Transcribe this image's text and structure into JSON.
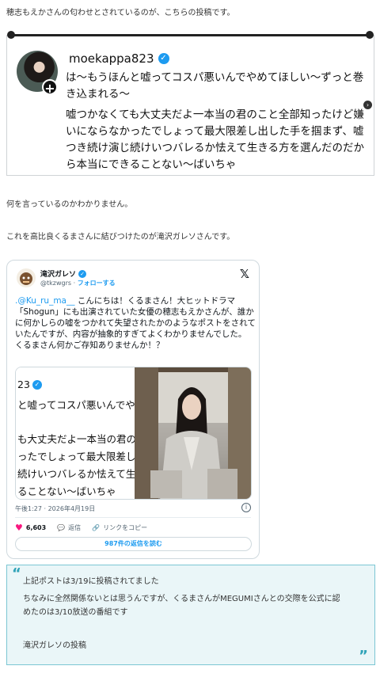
{
  "intro": "穂志もえかさんの匂わせとされているのが、こちらの投稿です。",
  "post1": {
    "username": "moekappa823",
    "text1": "は〜もうほんと嘘ってコスパ悪いんでやめてほしい〜ずっと巻き込まれる〜",
    "text2": "嘘つかなくても大丈夫だよ一本当の君のこと全部知ったけど嫌いにならなかったでしょって最大限差し出した手を掴まず、嘘つき続け演じ続けいつバレるか怯えて生きる方を選んだのだから本当にできることない〜ばいちゃ"
  },
  "para1": "何を言っているのかわかりません。",
  "para2": "これを高比良くるまさんに結びつけたのが滝沢ガレソさんです。",
  "tweet": {
    "display_name": "滝沢ガレソ",
    "handle": "@tkzwgrs",
    "follow": "フォローする",
    "mention": ".@Ku_ru_ma__",
    "body": " こんにちは！くるまさん！大ヒットドラマ「Shogun」にも出演されていた女優の穂志もえかさんが、誰かに何かしらの嘘をつかれて失望されたかのようなポストをされていたんですが、内容が抽象的すぎてよくわかりませんでした。",
    "body2": "くるまさん何かご存知ありませんか！？",
    "media_lines": [
      "23",
      "と嘘ってコスパ悪いんでや",
      "も大丈夫だよ一本当の君の",
      "ったでしょって最大限差し",
      "続けいつバレるか怯えて生",
      "ることない〜ばいちゃ"
    ],
    "timestamp": "午後1:27 · 2026年4月19日",
    "likes": "6,603",
    "reply": "返信",
    "copy_link": "リンクをコピー",
    "read_replies": "987件の返信を読む"
  },
  "quote": {
    "line1": "上記ポストは3/19に投稿されてました",
    "line2": "ちなみに全然関係ないとは思うんですが、くるまさんがMEGUMIさんとの交際を公式に認",
    "line3": "めたのは3/10放送の番組です",
    "source": "滝沢ガレソの投稿"
  }
}
